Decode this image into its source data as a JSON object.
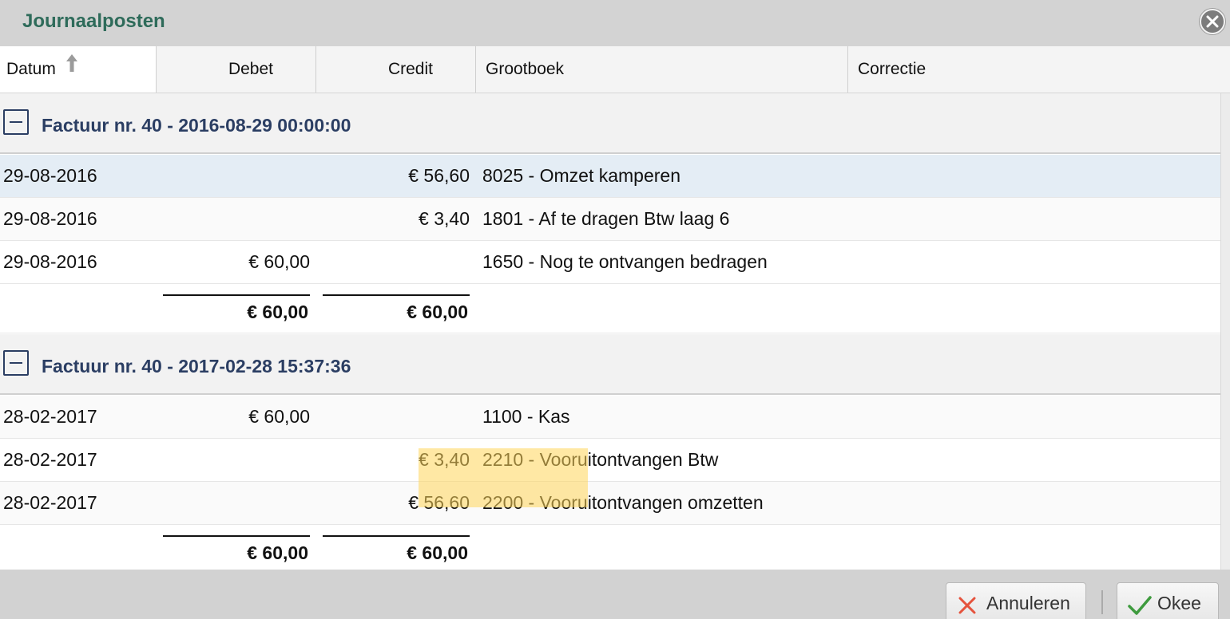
{
  "dialog": {
    "title": "Journaalposten"
  },
  "columns": {
    "datum": "Datum",
    "debet": "Debet",
    "credit": "Credit",
    "grootboek": "Grootboek",
    "correctie": "Correctie"
  },
  "groups": [
    {
      "title": "Factuur nr. 40 - 2016-08-29 00:00:00",
      "rows": [
        {
          "datum": "29-08-2016",
          "debet": "",
          "credit": "€ 56,60",
          "grootboek": "8025 - Omzet kamperen"
        },
        {
          "datum": "29-08-2016",
          "debet": "",
          "credit": "€ 3,40",
          "grootboek": "1801 - Af te dragen Btw laag 6"
        },
        {
          "datum": "29-08-2016",
          "debet": "€ 60,00",
          "credit": "",
          "grootboek": "1650 - Nog te ontvangen bedragen"
        }
      ],
      "total_debet": "€ 60,00",
      "total_credit": "€ 60,00"
    },
    {
      "title": "Factuur nr. 40 - 2017-02-28 15:37:36",
      "rows": [
        {
          "datum": "28-02-2017",
          "debet": "€ 60,00",
          "credit": "",
          "grootboek": "1100 - Kas"
        },
        {
          "datum": "28-02-2017",
          "debet": "",
          "credit": "€ 3,40",
          "grootboek": "2210 - Vooruitontvangen Btw"
        },
        {
          "datum": "28-02-2017",
          "debet": "",
          "credit": "€ 56,60",
          "grootboek": "2200 - Vooruitontvangen omzetten"
        }
      ],
      "total_debet": "€ 60,00",
      "total_credit": "€ 60,00"
    }
  ],
  "footer": {
    "cancel_label": "Annuleren",
    "ok_label": "Okee"
  },
  "colors": {
    "title": "#2e6b5a",
    "group_title": "#2b3e63",
    "selected_row": "#e4edf5",
    "highlight": "#ffd65a"
  },
  "icons": {
    "close": "close-circle-icon",
    "sort": "sort-ascending-icon",
    "collapse": "collapse-icon",
    "cancel": "cross-icon",
    "ok": "checkmark-icon"
  }
}
